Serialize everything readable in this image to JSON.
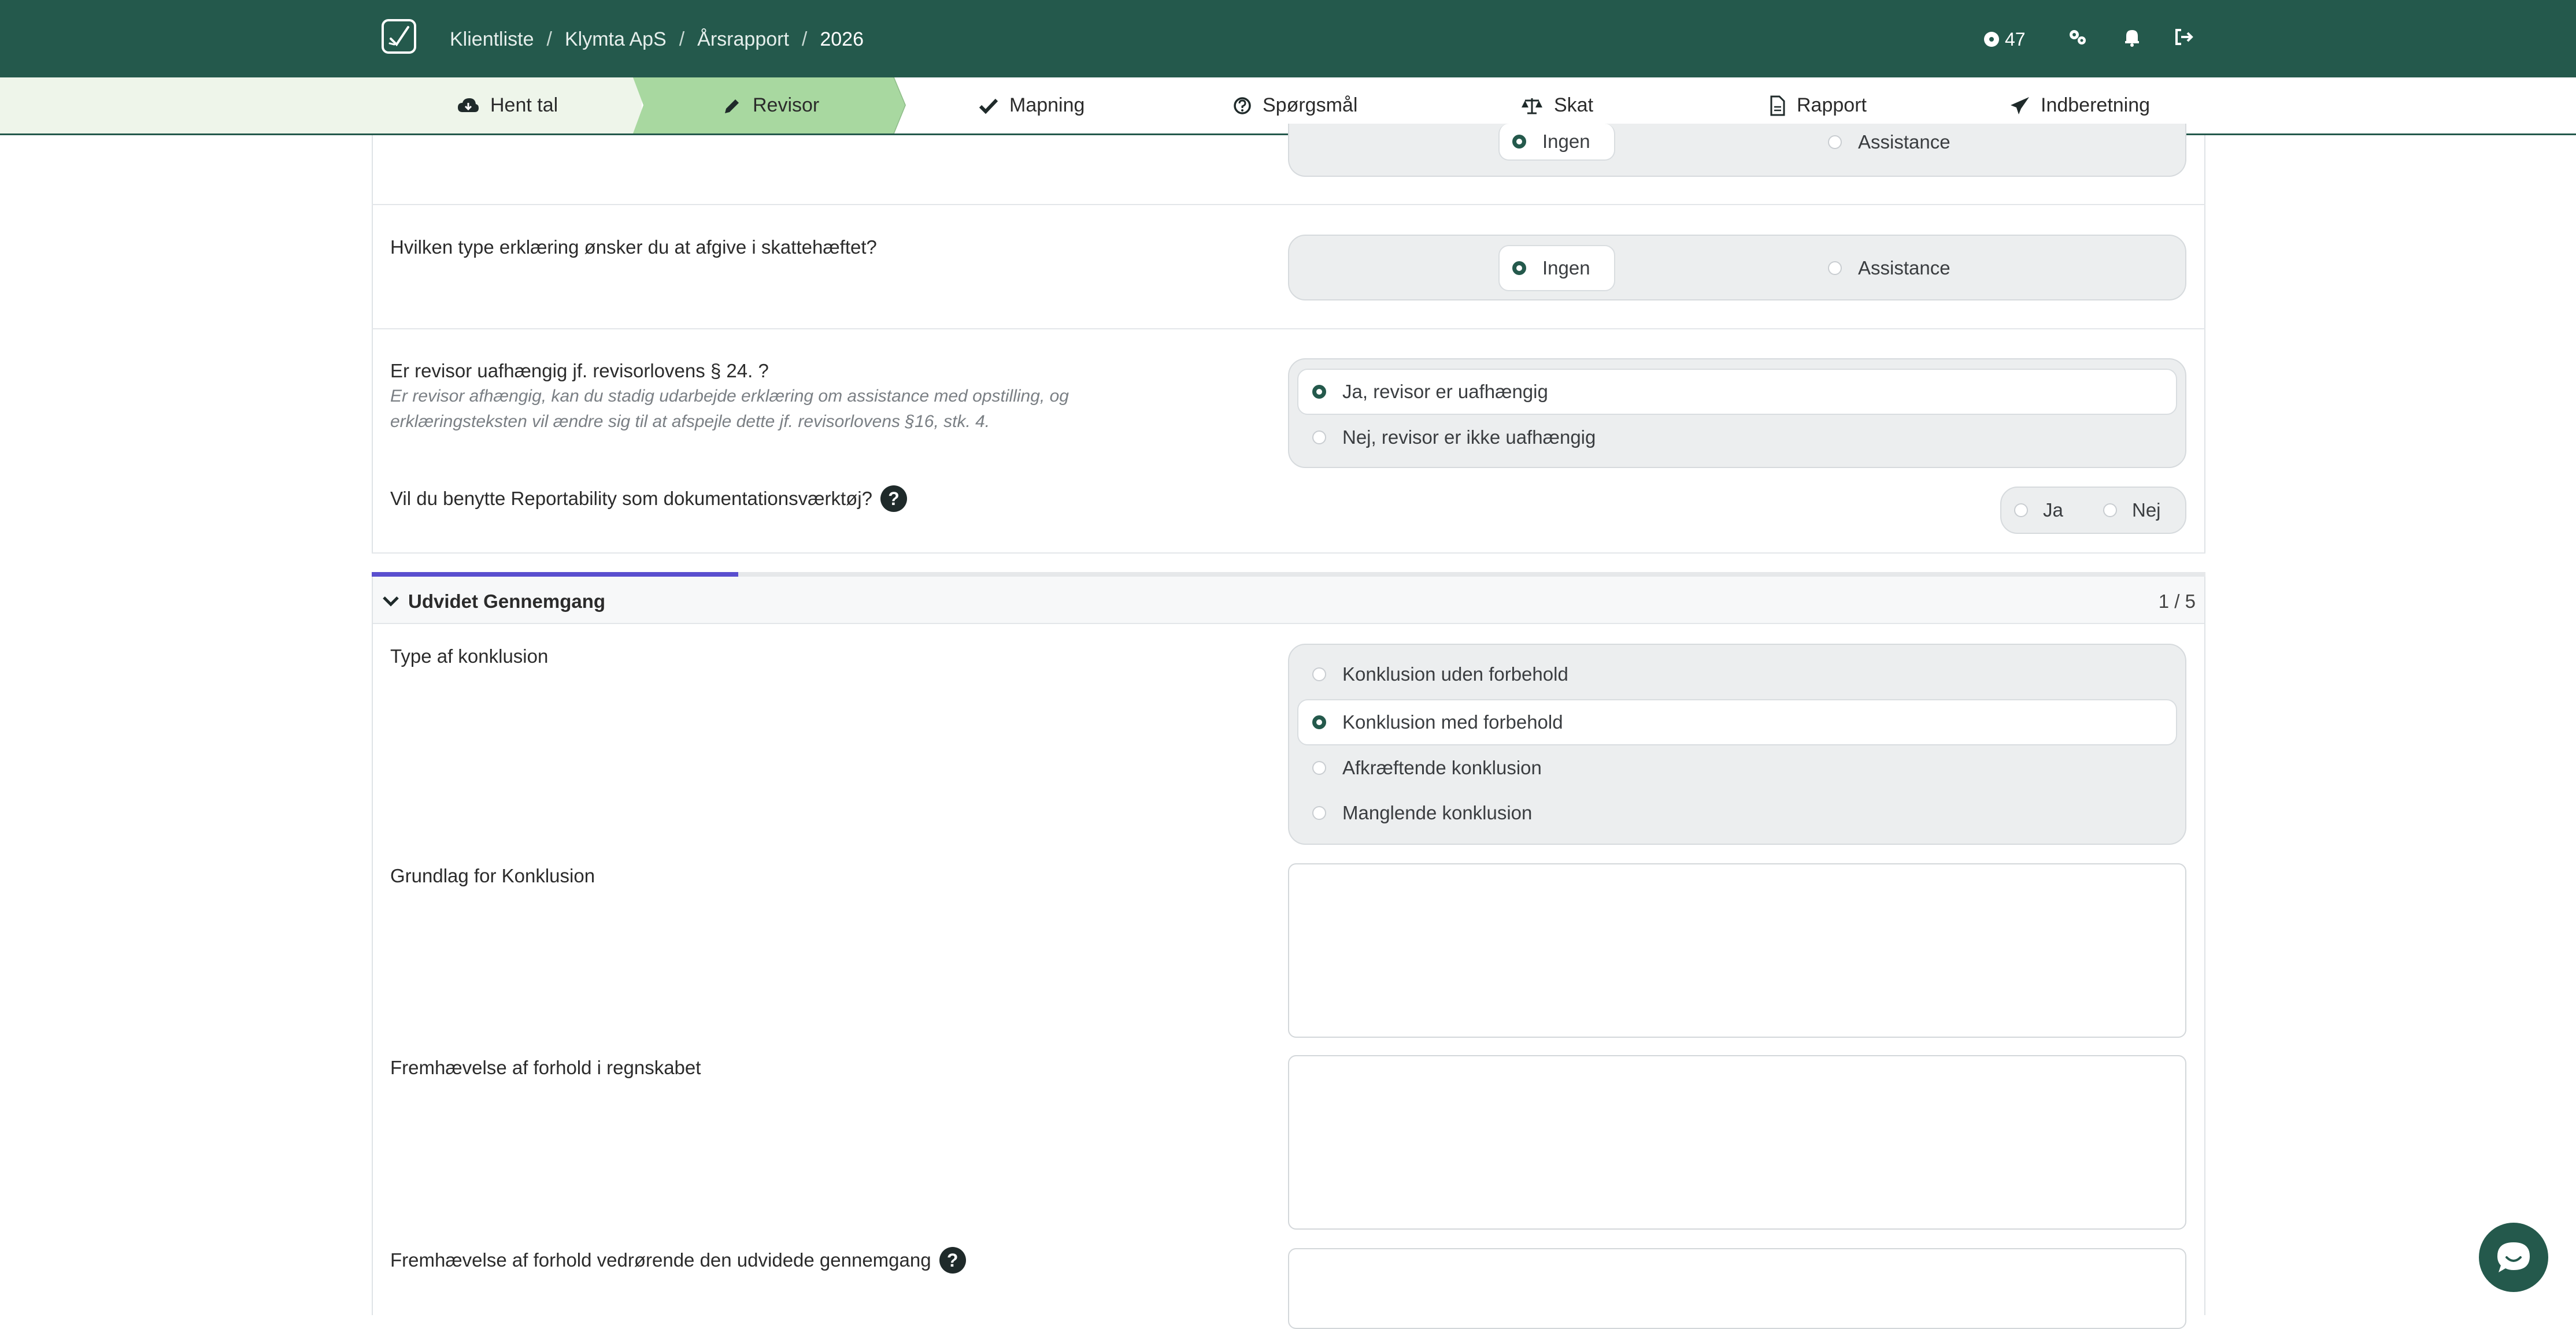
{
  "header": {
    "breadcrumb": [
      "Klientliste",
      "Klymta ApS",
      "Årsrapport",
      "2026"
    ],
    "separator": "/",
    "credits": "47",
    "icons": [
      "logo-icon",
      "credits-icon",
      "settings-icon",
      "bell-icon",
      "logout-icon"
    ]
  },
  "steps": [
    {
      "label": "Hent tal",
      "icon": "cloud-download-icon",
      "state": "done"
    },
    {
      "label": "Revisor",
      "icon": "pencil-icon",
      "state": "active"
    },
    {
      "label": "Mapning",
      "icon": "check-icon",
      "state": "todo"
    },
    {
      "label": "Spørgsmål",
      "icon": "question-circle-icon",
      "state": "todo"
    },
    {
      "label": "Skat",
      "icon": "scale-icon",
      "state": "todo"
    },
    {
      "label": "Rapport",
      "icon": "document-icon",
      "state": "todo"
    },
    {
      "label": "Indberetning",
      "icon": "send-icon",
      "state": "todo"
    }
  ],
  "questions": {
    "top_partial": {
      "options": [
        "Ingen",
        "Assistance"
      ],
      "selected": "Ingen"
    },
    "tax_declaration": {
      "label": "Hvilken type erklæring ønsker du at afgive i skattehæftet?",
      "options": [
        "Ingen",
        "Assistance"
      ],
      "selected": "Ingen"
    },
    "independence": {
      "label": "Er revisor uafhængig jf. revisorlovens § 24. ?",
      "help_line1": "Er revisor afhængig, kan du stadig udarbejde erklæring om assistance med opstilling, og",
      "help_line2": "erklæringsteksten vil ændre sig til at afspejle dette jf. revisorlovens §16, stk. 4.",
      "options": [
        "Ja, revisor er uafhængig",
        "Nej, revisor er ikke uafhængig"
      ],
      "selected": "Ja, revisor er uafhængig"
    },
    "reportability": {
      "label": "Vil du benytte Reportability som dokumentationsværktøj?",
      "help_icon": "?",
      "options": [
        "Ja",
        "Nej"
      ],
      "selected": null
    }
  },
  "section": {
    "title": "Udvidet Gennemgang",
    "count": "1 / 5",
    "progress_fraction": 0.2,
    "colors": {
      "progress": "#5a4fcf"
    }
  },
  "extended": {
    "conclusion_type": {
      "label": "Type af konklusion",
      "options": [
        "Konklusion uden forbehold",
        "Konklusion med forbehold",
        "Afkræftende konklusion",
        "Manglende konklusion"
      ],
      "selected": "Konklusion med forbehold"
    },
    "basis": {
      "label": "Grundlag for Konklusion",
      "value": ""
    },
    "emphasis_accounts": {
      "label": "Fremhævelse af forhold i regnskabet",
      "value": ""
    },
    "emphasis_review": {
      "label": "Fremhævelse af forhold vedrørende den udvidede gennemgang",
      "help_icon": "?",
      "value": ""
    }
  },
  "colors": {
    "brand": "#24594c",
    "done_step": "#eef5ea",
    "active_step": "#a8d8a0"
  },
  "chat": {
    "icon": "chat-icon"
  }
}
